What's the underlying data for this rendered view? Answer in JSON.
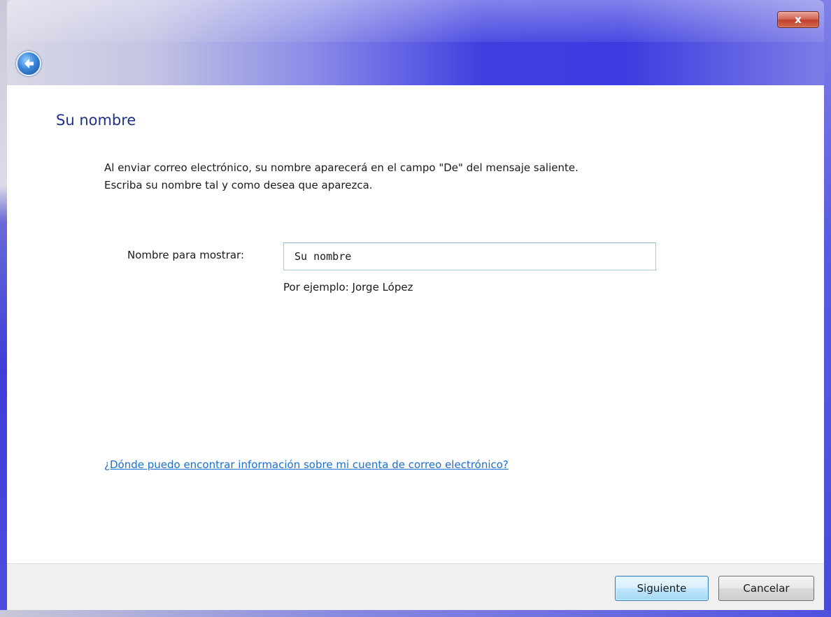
{
  "window": {
    "close_label": "x"
  },
  "wizard": {
    "title": "Su nombre",
    "intro_line1": "Al enviar correo electrónico, su nombre aparecerá en el campo \"De\" del mensaje saliente.",
    "intro_line2": "Escriba su nombre tal y como desea que aparezca.",
    "display_name_label": "Nombre para mostrar:",
    "display_name_value": "Su nombre",
    "example_text": "Por ejemplo: Jorge López",
    "help_link": "¿Dónde puedo encontrar información sobre mi cuenta de correo electrónico?"
  },
  "footer": {
    "next_label": "Siguiente",
    "cancel_label": "Cancelar"
  },
  "icons": {
    "back": "back-arrow-icon",
    "close": "close-icon"
  },
  "colors": {
    "title": "#1e3287",
    "link": "#1b6fd1",
    "titlebar_accent": "#3f3fe0"
  }
}
